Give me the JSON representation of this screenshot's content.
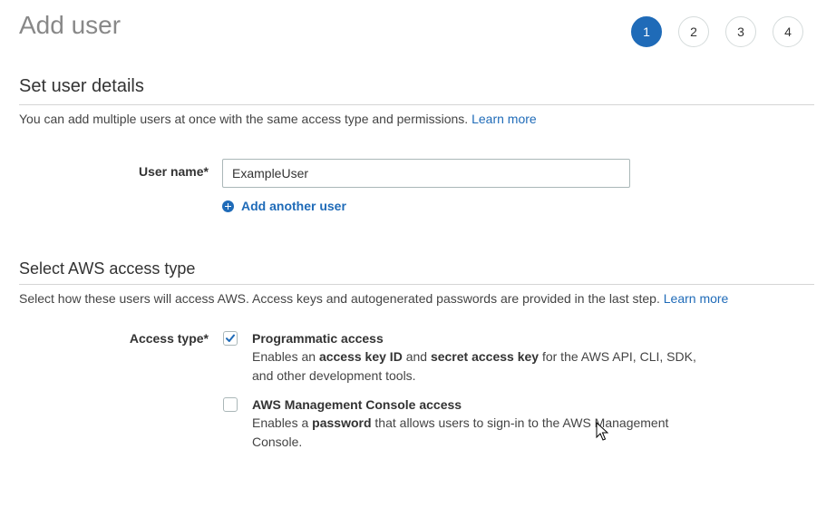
{
  "header": {
    "title": "Add user",
    "steps": [
      "1",
      "2",
      "3",
      "4"
    ],
    "active_step": "1"
  },
  "details": {
    "title": "Set user details",
    "description": "You can add multiple users at once with the same access type and permissions.",
    "learn_more": "Learn more",
    "user_name_label": "User name*",
    "user_name_value": "ExampleUser",
    "add_another_label": "Add another user"
  },
  "access": {
    "title": "Select AWS access type",
    "description": "Select how these users will access AWS. Access keys and autogenerated passwords are provided in the last step.",
    "learn_more": "Learn more",
    "access_type_label": "Access type*",
    "options": [
      {
        "title": "Programmatic access",
        "checked": true,
        "desc_parts": [
          "Enables an ",
          "access key ID",
          " and ",
          "secret access key",
          " for the AWS API, CLI, SDK, and other development tools."
        ]
      },
      {
        "title": "AWS Management Console access",
        "checked": false,
        "desc_parts": [
          "Enables a ",
          "password",
          " that allows users to sign-in to the AWS Management Console."
        ]
      }
    ]
  },
  "colors": {
    "accent": "#1f6bb8",
    "title_gray": "#888888",
    "border": "#aab7b8"
  },
  "icons": [
    "plus-circle-icon",
    "checkmark-icon",
    "mouse-cursor-icon"
  ]
}
